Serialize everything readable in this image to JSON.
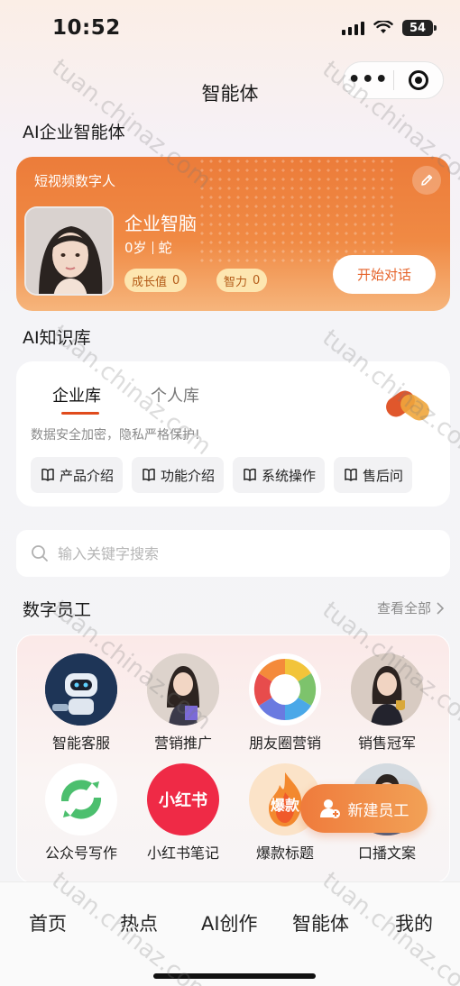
{
  "status": {
    "time": "10:52",
    "battery": "54"
  },
  "nav": {
    "title": "智能体"
  },
  "sections": {
    "enterprise_agent": "AI企业智能体",
    "knowledge": "AI知识库",
    "employees": "数字员工"
  },
  "agent": {
    "type": "短视频数字人",
    "name": "企业智脑",
    "age": "0岁",
    "zodiac": "蛇",
    "growth_label": "成长值",
    "growth_value": "0",
    "iq_label": "智力",
    "iq_value": "0",
    "start_chat": "开始对话"
  },
  "knowledge": {
    "tabs": [
      "企业库",
      "个人库"
    ],
    "description": "数据安全加密，隐私严格保护!",
    "chips": [
      "产品介绍",
      "功能介绍",
      "系统操作",
      "售后问"
    ]
  },
  "search": {
    "placeholder": "输入关键字搜索"
  },
  "employees": {
    "view_all": "查看全部",
    "items": [
      {
        "label": "智能客服",
        "icon": "robot-icon"
      },
      {
        "label": "营销推广",
        "icon": "marketer-avatar"
      },
      {
        "label": "朋友圈营销",
        "icon": "moments-icon"
      },
      {
        "label": "销售冠军",
        "icon": "sales-avatar"
      },
      {
        "label": "公众号写作",
        "icon": "wechat-official-icon"
      },
      {
        "label": "小红书笔记",
        "icon": "xiaohongshu-icon",
        "logo_text": "小红书"
      },
      {
        "label": "爆款标题",
        "icon": "hot-title-icon",
        "logo_text": "爆款"
      },
      {
        "label": "口播文案",
        "icon": "presenter-avatar"
      }
    ],
    "new_button": "新建员工"
  },
  "tabbar": [
    "首页",
    "热点",
    "AI创作",
    "智能体",
    "我的"
  ],
  "watermark": "tuan.chinaz.com",
  "colors": {
    "accent": "#ef7b3c",
    "underline": "#e04b1c",
    "chip_bg": "#fde6b0"
  }
}
